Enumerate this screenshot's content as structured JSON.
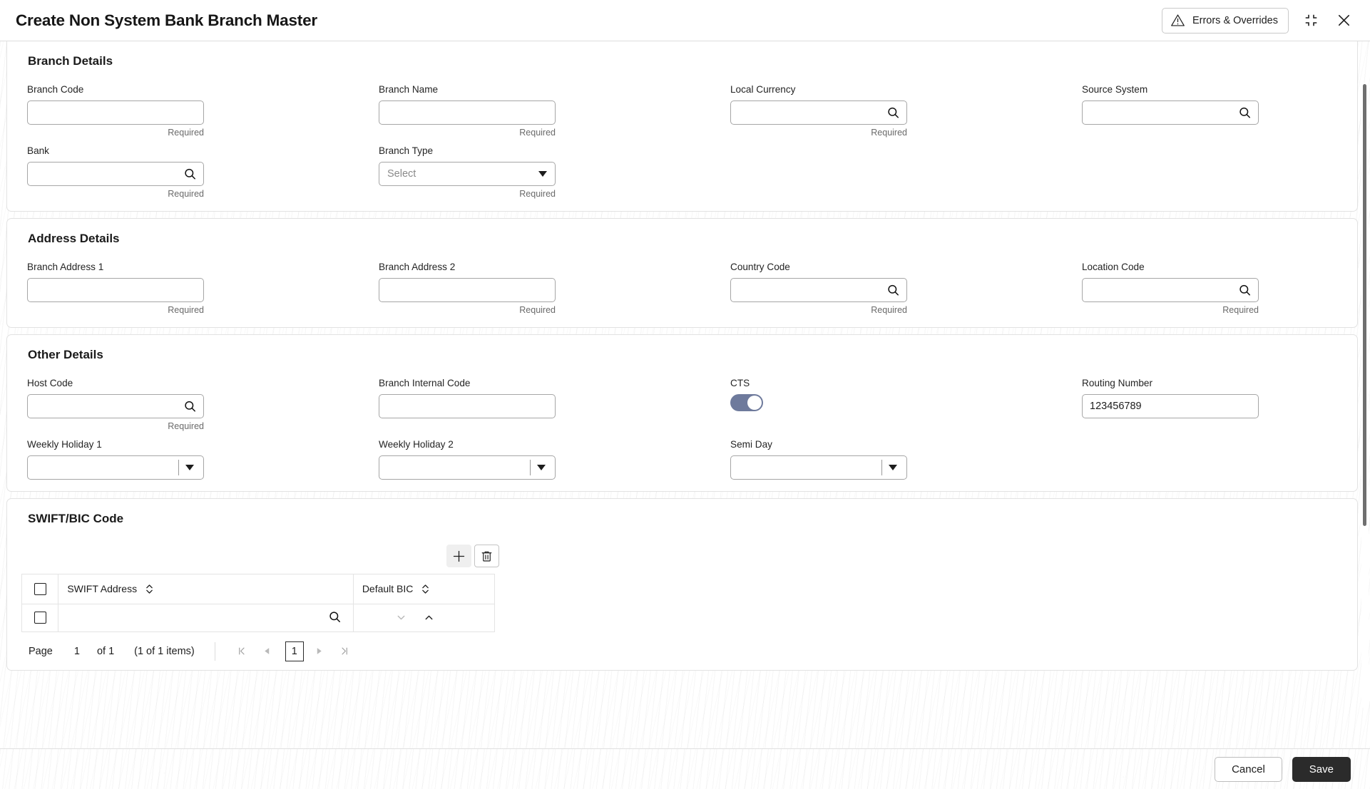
{
  "header": {
    "title": "Create Non System Bank Branch Master",
    "errors_button": "Errors & Overrides",
    "warning_icon": "warning-triangle-icon",
    "minimize_icon": "collapse-icon",
    "close_icon": "close-icon"
  },
  "sections": {
    "branch_details": {
      "title": "Branch Details",
      "fields": [
        {
          "label": "Branch Code",
          "type": "text",
          "value": "",
          "helper": "Required"
        },
        {
          "label": "Branch Name",
          "type": "text",
          "value": "",
          "helper": "Required"
        },
        {
          "label": "Local Currency",
          "type": "search",
          "value": "",
          "helper": "Required"
        },
        {
          "label": "Source System",
          "type": "search",
          "value": "",
          "helper": ""
        },
        {
          "label": "Bank",
          "type": "search",
          "value": "",
          "helper": "Required"
        },
        {
          "label": "Branch Type",
          "type": "select",
          "value": "Select",
          "placeholder": true,
          "helper": "Required"
        }
      ]
    },
    "address_details": {
      "title": "Address Details",
      "fields": [
        {
          "label": "Branch Address 1",
          "type": "text",
          "value": "",
          "helper": "Required"
        },
        {
          "label": "Branch Address 2",
          "type": "text",
          "value": "",
          "helper": "Required"
        },
        {
          "label": "Country Code",
          "type": "search",
          "value": "",
          "helper": "Required"
        },
        {
          "label": "Location Code",
          "type": "search",
          "value": "",
          "helper": "Required"
        }
      ]
    },
    "other_details": {
      "title": "Other Details",
      "fields": [
        {
          "label": "Host Code",
          "type": "search",
          "value": "",
          "helper": "Required"
        },
        {
          "label": "Branch Internal Code",
          "type": "text",
          "value": "",
          "helper": ""
        },
        {
          "label": "CTS",
          "type": "toggle",
          "value": "on",
          "helper": ""
        },
        {
          "label": "Routing Number",
          "type": "text",
          "value": "123456789",
          "helper": ""
        },
        {
          "label": "Weekly Holiday 1",
          "type": "select-divided",
          "value": "",
          "helper": ""
        },
        {
          "label": "Weekly Holiday 2",
          "type": "select-divided",
          "value": "",
          "helper": ""
        },
        {
          "label": "Semi Day",
          "type": "select-divided",
          "value": "",
          "helper": ""
        }
      ]
    },
    "swift": {
      "title": "SWIFT/BIC Code",
      "add_icon": "plus-icon",
      "delete_icon": "trash-icon",
      "columns": [
        "SWIFT Address",
        "Default BIC"
      ],
      "rows": [
        {
          "swift_address": "",
          "default_bic": ""
        }
      ],
      "pagination": {
        "page_label": "Page",
        "page_number": "1",
        "of_label": "of 1",
        "items_label": "(1 of 1 items)",
        "current_page": "1",
        "first_icon": "first-page-icon",
        "prev_icon": "prev-page-icon",
        "next_icon": "next-page-icon",
        "last_icon": "last-page-icon"
      }
    }
  },
  "footer": {
    "cancel_label": "Cancel",
    "save_label": "Save"
  },
  "colors": {
    "toggle_on": "#6e7a9c",
    "save_bg": "#2b2b2b",
    "helper_text": "#6a6a6a"
  }
}
